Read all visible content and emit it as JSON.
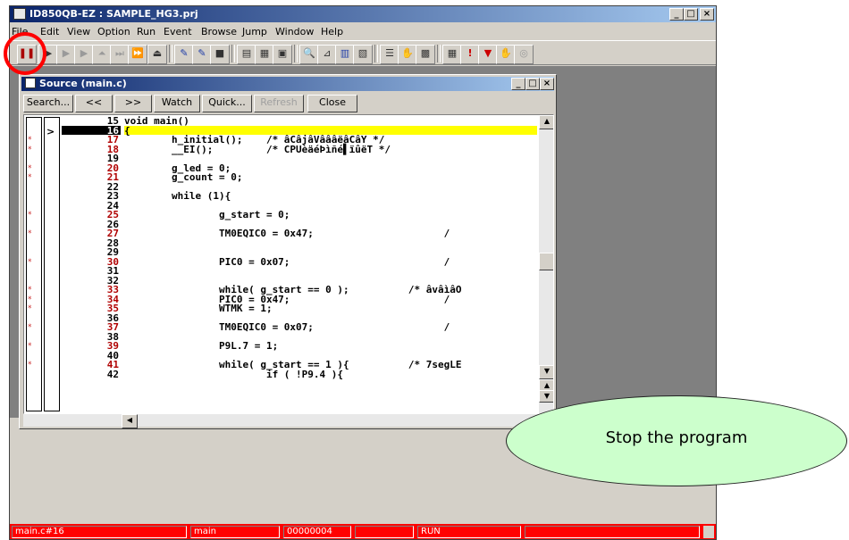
{
  "app": {
    "title": "ID850QB-EZ : SAMPLE_HG3.prj",
    "minimize": "_",
    "restore": "□",
    "close": "×"
  },
  "menu": [
    "File",
    "Edit",
    "View",
    "Option",
    "Run",
    "Event",
    "Browse",
    "Jump",
    "Window",
    "Help"
  ],
  "toolbar": {
    "pause": "❚❚",
    "items": [
      "▶",
      "▶",
      "▶",
      "⏶",
      "⏭",
      "⏩",
      "⏏",
      "✎",
      "✎",
      "■",
      "▤",
      "▦",
      "▣",
      "🔍",
      "⊿",
      "▥",
      "▧",
      "☰",
      "✋",
      "▩",
      "▦",
      "!",
      "▼",
      "✋",
      "◎"
    ]
  },
  "source_window": {
    "title": "Source (main.c)",
    "buttons": {
      "search": "Search...",
      "prev": "<<",
      "next": ">>",
      "watch": "Watch",
      "quick": "Quick...",
      "refresh": "Refresh",
      "close": "Close"
    },
    "current_marker": ">",
    "lines": [
      {
        "n": "15",
        "code": "void main()",
        "mark": ""
      },
      {
        "n": "16",
        "code": "{",
        "mark": ""
      },
      {
        "n": "17",
        "code": "        h_initial();    /* âCâjâVâââëâCâY */",
        "mark": "*"
      },
      {
        "n": "18",
        "code": "        __EI();         /* CPUèäéÞìñé▌ïûëT */",
        "mark": "*"
      },
      {
        "n": "19",
        "code": "",
        "mark": ""
      },
      {
        "n": "20",
        "code": "        g_led = 0;",
        "mark": "*"
      },
      {
        "n": "21",
        "code": "        g_count = 0;",
        "mark": "*"
      },
      {
        "n": "22",
        "code": "",
        "mark": ""
      },
      {
        "n": "23",
        "code": "        while (1){",
        "mark": ""
      },
      {
        "n": "24",
        "code": "",
        "mark": ""
      },
      {
        "n": "25",
        "code": "                g_start = 0;",
        "mark": "*"
      },
      {
        "n": "26",
        "code": "",
        "mark": ""
      },
      {
        "n": "27",
        "code": "                TM0EQIC0 = 0x47;                      /",
        "mark": "*"
      },
      {
        "n": "28",
        "code": "",
        "mark": ""
      },
      {
        "n": "29",
        "code": "",
        "mark": ""
      },
      {
        "n": "30",
        "code": "                PIC0 = 0x07;                          /",
        "mark": "*"
      },
      {
        "n": "31",
        "code": "",
        "mark": ""
      },
      {
        "n": "32",
        "code": "",
        "mark": ""
      },
      {
        "n": "33",
        "code": "                while( g_start == 0 );          /* âvâìâO",
        "mark": "*"
      },
      {
        "n": "34",
        "code": "                PIC0 = 0x47;                          /",
        "mark": "*"
      },
      {
        "n": "35",
        "code": "                WTMK = 1;",
        "mark": "*"
      },
      {
        "n": "36",
        "code": "",
        "mark": ""
      },
      {
        "n": "37",
        "code": "                TM0EQIC0 = 0x07;                      /",
        "mark": "*"
      },
      {
        "n": "38",
        "code": "",
        "mark": ""
      },
      {
        "n": "39",
        "code": "                P9L.7 = 1;",
        "mark": "*"
      },
      {
        "n": "40",
        "code": "",
        "mark": ""
      },
      {
        "n": "41",
        "code": "                while( g_start == 1 ){          /* 7segLE",
        "mark": "*"
      },
      {
        "n": "42",
        "code": "                        if ( !P9.4 ){",
        "mark": ""
      }
    ]
  },
  "status": {
    "location": "main.c#16",
    "function": "main",
    "address": "00000004",
    "blank": "",
    "state": "RUN"
  },
  "callout": {
    "text": "Stop the program"
  },
  "colors": {
    "status_bar": "#ff0000",
    "callout_fill": "#ccffcc",
    "current_line": "#ffff00",
    "highlight_ring": "#ff0000"
  }
}
